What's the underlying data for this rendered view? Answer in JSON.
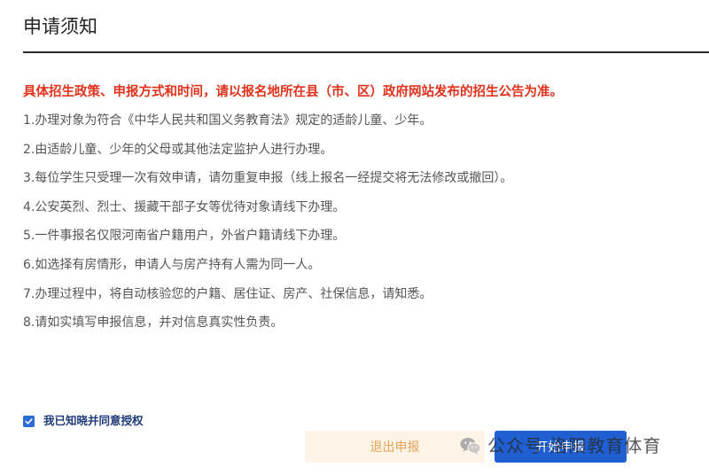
{
  "header": {
    "title": "申请须知"
  },
  "notice": {
    "warning": "具体招生政策、申报方式和时间，请以报名地所在县（市、区）政府网站发布的招生公告为准。",
    "rules": [
      "1.办理对象为符合《中华人民共和国义务教育法》规定的适龄儿童、少年。",
      "2.由适龄儿童、少年的父母或其他法定监护人进行办理。",
      "3.每位学生只受理一次有效申请，请勿重复申报（线上报名一经提交将无法修改或撤回）。",
      "4.公安英烈、烈士、援藏干部子女等优待对象请线下办理。",
      "5.一件事报名仅限河南省户籍用户，外省户籍请线下办理。",
      "6.如选择有房情形，申请人与房产持有人需为同一人。",
      "7.办理过程中，将自动核验您的户籍、居住证、房产、社保信息，请知悉。",
      "8.请如实填写申报信息，并对信息真实性负责。"
    ]
  },
  "agreement": {
    "checked": true,
    "label": "我已知晓并同意授权"
  },
  "actions": {
    "exit_label": "退出申报",
    "start_label": "开始申报"
  },
  "watermark": {
    "text": "公众号·洛阳教育体育",
    "icon": "wechat-icon"
  },
  "colors": {
    "warning": "#e0321c",
    "primary": "#1f5fd2",
    "exit_bg": "#fdf3e6",
    "exit_text": "#e8a35a"
  }
}
